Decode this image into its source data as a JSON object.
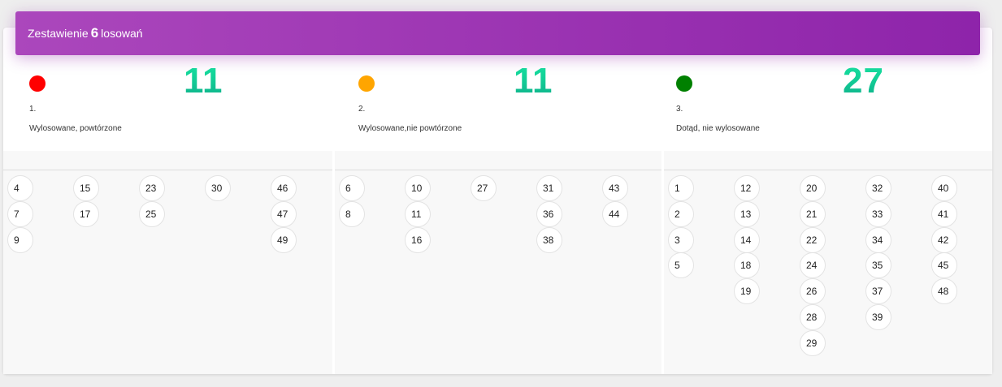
{
  "header": {
    "title_prefix": "Zestawienie",
    "draw_count": "6",
    "title_suffix": "losowań"
  },
  "stats": [
    {
      "color": "#ff0000",
      "big": "11",
      "num": "1.",
      "desc": "Wylosowane, powtórzone"
    },
    {
      "color": "#ffa500",
      "big": "11",
      "num": "2.",
      "desc": "Wylosowane,nie powtórzone"
    },
    {
      "color": "#008000",
      "big": "27",
      "num": "3.",
      "desc": "Dotąd, nie wylosowane"
    }
  ],
  "columns": [
    {
      "numbers": [
        [
          4,
          7,
          9
        ],
        [
          15,
          17
        ],
        [
          23,
          25
        ],
        [
          30
        ],
        [
          46,
          47,
          49
        ]
      ]
    },
    {
      "numbers": [
        [
          6,
          8
        ],
        [
          10,
          11,
          16
        ],
        [
          27
        ],
        [
          31,
          36,
          38
        ],
        [
          43,
          44
        ]
      ]
    },
    {
      "numbers": [
        [
          1,
          2,
          3,
          5
        ],
        [
          12,
          13,
          14,
          18,
          19
        ],
        [
          20,
          21,
          22,
          24,
          26,
          28,
          29
        ],
        [
          32,
          33,
          34,
          35,
          37,
          39
        ],
        [
          40,
          41,
          42,
          45,
          48
        ]
      ]
    }
  ]
}
